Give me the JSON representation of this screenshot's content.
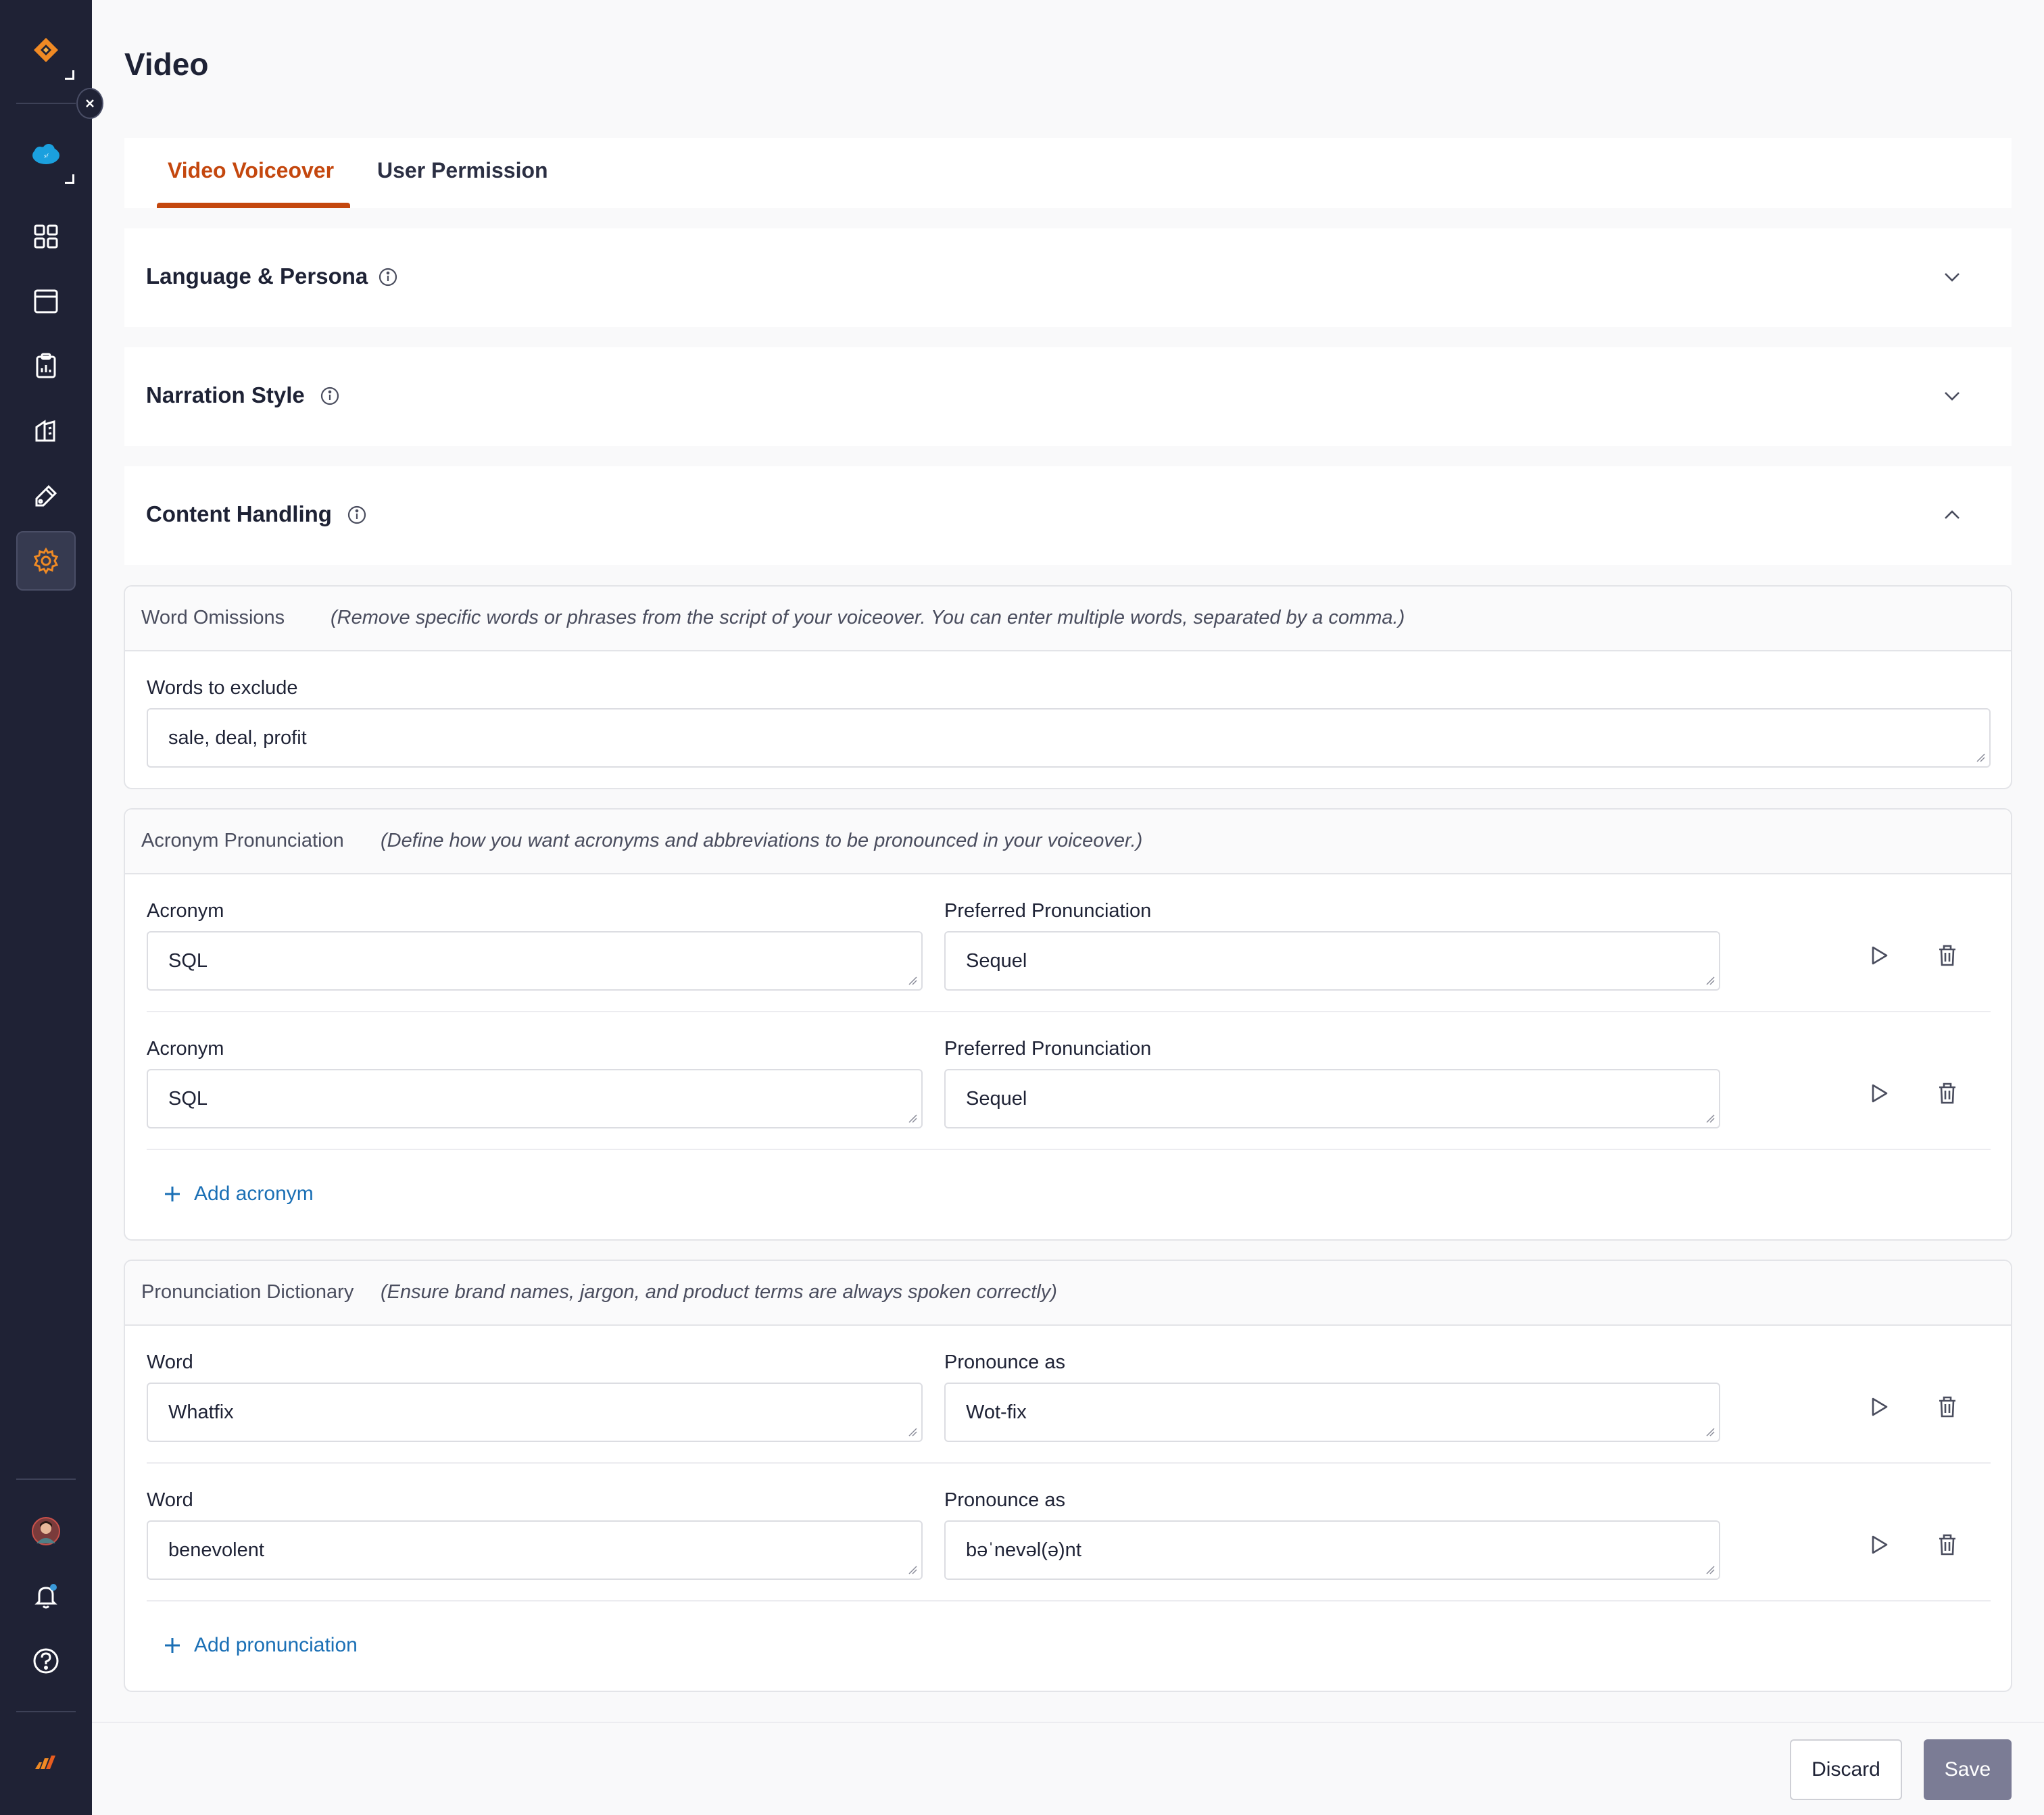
{
  "page_title": "Video",
  "tabs": [
    {
      "label": "Video Voiceover",
      "active": true
    },
    {
      "label": "User Permission",
      "active": false
    }
  ],
  "accordions": [
    {
      "title": "Language & Persona",
      "state": "collapsed"
    },
    {
      "title": "Narration Style",
      "state": "collapsed"
    },
    {
      "title": "Content Handling",
      "state": "expanded"
    }
  ],
  "word_omissions": {
    "title": "Word Omissions",
    "description": "(Remove specific words or phrases from the script of your voiceover. You can enter multiple words, separated by a comma.)",
    "field_label": "Words to exclude",
    "field_value": "sale, deal, profit"
  },
  "acronym_pronunciation": {
    "title": "Acronym Pronunciation",
    "description": "(Define how you want acronyms and abbreviations to be pronounced in your voiceover.)",
    "rows": [
      {
        "left_label": "Acronym",
        "left_value": "SQL",
        "right_label": "Preferred Pronunciation",
        "right_value": "Sequel"
      },
      {
        "left_label": "Acronym",
        "left_value": "SQL",
        "right_label": "Preferred Pronunciation",
        "right_value": "Sequel"
      }
    ],
    "add_label": "Add acronym"
  },
  "pronunciation_dictionary": {
    "title": "Pronunciation Dictionary",
    "description": "(Ensure brand names, jargon, and product terms are always spoken correctly)",
    "rows": [
      {
        "left_label": "Word",
        "left_value": "Whatfix",
        "right_label": "Pronounce as",
        "right_value": "Wot-fix"
      },
      {
        "left_label": "Word",
        "left_value": "benevolent",
        "right_label": "Pronounce as",
        "right_value": "bəˈnevəl(ə)nt"
      }
    ],
    "add_label": "Add pronunciation"
  },
  "footer": {
    "discard_label": "Discard",
    "save_label": "Save"
  },
  "sidebar": {
    "icons": [
      "logo-icon",
      "salesforce-icon",
      "dashboard-icon",
      "calendar-icon",
      "report-icon",
      "content-icon",
      "design-icon",
      "settings-icon",
      "avatar",
      "bell-icon",
      "help-icon",
      "whatfix-logo-icon"
    ],
    "active": "settings-icon"
  },
  "colors": {
    "sidebar_bg": "#1f2235",
    "accent": "#c4470e",
    "link": "#1a6fb5",
    "save_bg": "#7b7c95",
    "logo_orange": "#f08a24"
  }
}
